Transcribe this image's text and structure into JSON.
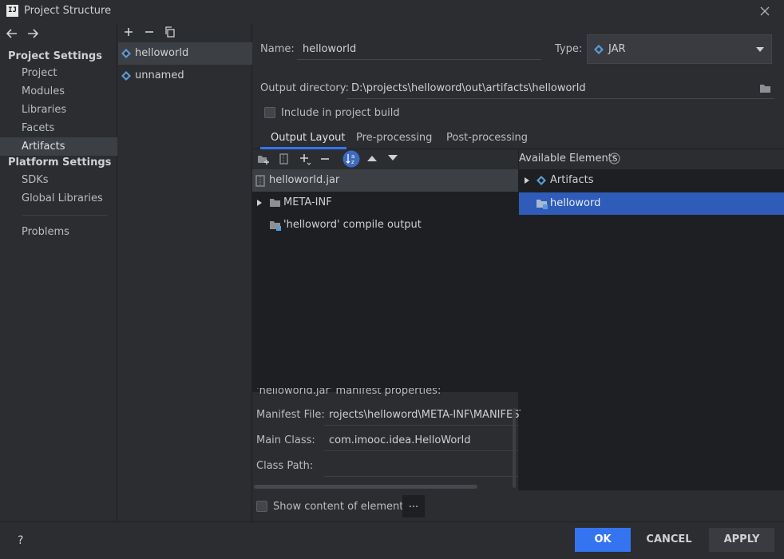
{
  "window": {
    "title": "Project Structure",
    "app_icon": "IJ"
  },
  "nav": {
    "project_settings_header": "Project Settings",
    "project_items": [
      "Project",
      "Modules",
      "Libraries",
      "Facets",
      "Artifacts"
    ],
    "selected": "Artifacts",
    "platform_settings_header": "Platform Settings",
    "platform_items": [
      "SDKs",
      "Global Libraries"
    ],
    "problems": "Problems"
  },
  "artifacts": {
    "items": [
      "helloworld",
      "unnamed"
    ],
    "selected": "helloworld"
  },
  "editor": {
    "name_label": "Name:",
    "name_value": "helloworld",
    "type_label": "Type:",
    "type_value": "JAR",
    "output_dir_label": "Output directory:",
    "output_dir_value": "D:\\projects\\helloword\\out\\artifacts\\helloworld",
    "include_in_build_label": "Include in project build",
    "include_in_build_checked": false,
    "tabs": [
      "Output Layout",
      "Pre-processing",
      "Post-processing"
    ],
    "active_tab": "Output Layout"
  },
  "output_layout": {
    "items": [
      {
        "label": "helloworld.jar",
        "icon": "jar-icon"
      },
      {
        "label": "META-INF",
        "icon": "folder-icon"
      },
      {
        "label": "'helloword' compile output",
        "icon": "module-folder-icon"
      }
    ]
  },
  "available": {
    "header": "Available Elements",
    "items": [
      {
        "label": "Artifacts",
        "icon": "artifact-icon"
      },
      {
        "label": "helloword",
        "icon": "module-folder-icon"
      }
    ],
    "selected": "helloword"
  },
  "manifest": {
    "header_text": "'helloworld.jar' manifest properties:",
    "manifest_file_label": "Manifest File:",
    "manifest_file_value": "rojects\\helloword\\META-INF\\MANIFEST.MF",
    "main_class_label": "Main Class:",
    "main_class_value": "com.imooc.idea.HelloWorld",
    "class_path_label": "Class Path:",
    "class_path_value": ""
  },
  "show_content": {
    "label": "Show content of elements",
    "checked": false,
    "more_button": "..."
  },
  "footer": {
    "help": "?",
    "ok": "OK",
    "cancel": "CANCEL",
    "apply": "APPLY"
  },
  "colors": {
    "accent": "#3574f0",
    "bg": "#2b2d30",
    "pane": "#1e1f22",
    "icon_blue": "#5b9bd5"
  }
}
